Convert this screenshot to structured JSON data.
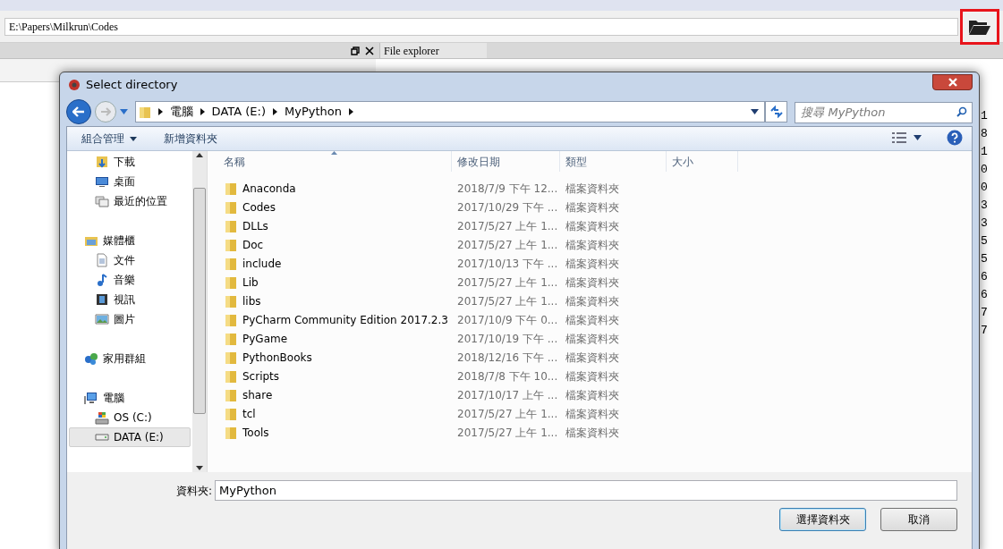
{
  "toolbar": {
    "path": "E:\\Papers\\Milkrun\\Codes"
  },
  "pane_header": {
    "title": "File explorer"
  },
  "background_column": [
    "1",
    "8",
    "1",
    "0",
    "0",
    "3",
    "3",
    "5",
    "5",
    "6",
    "6",
    "7",
    "7"
  ],
  "dialog": {
    "title": "Select directory",
    "breadcrumbs": [
      "電腦",
      "DATA (E:)",
      "MyPython"
    ],
    "search": {
      "placeholder": "搜尋 MyPython"
    },
    "commands": [
      {
        "label": "組合管理",
        "dropdown": true
      },
      {
        "label": "新增資料夾",
        "dropdown": false
      }
    ],
    "nav": [
      {
        "children": [
          {
            "label": "下載",
            "kind": "download",
            "selected": false
          },
          {
            "label": "桌面",
            "kind": "desktop",
            "selected": false
          },
          {
            "label": "最近的位置",
            "kind": "recent",
            "selected": false
          }
        ]
      },
      {
        "label": "媒體櫃",
        "kind": "library",
        "selected": false,
        "children": [
          {
            "label": "文件",
            "kind": "document",
            "selected": false
          },
          {
            "label": "音樂",
            "kind": "music",
            "selected": false
          },
          {
            "label": "視訊",
            "kind": "video",
            "selected": false
          },
          {
            "label": "圖片",
            "kind": "picture",
            "selected": false
          }
        ]
      },
      {
        "label": "家用群組",
        "kind": "homegroup",
        "selected": false
      },
      {
        "label": "電腦",
        "kind": "computer",
        "selected": false,
        "children": [
          {
            "label": "OS (C:)",
            "kind": "osdrive",
            "selected": false
          },
          {
            "label": "DATA (E:)",
            "kind": "drive",
            "selected": true
          }
        ]
      }
    ],
    "columns": [
      "名稱",
      "修改日期",
      "類型",
      "大小"
    ],
    "rows": [
      {
        "name": "Anaconda",
        "modified": "2018/7/9 下午 12...",
        "type": "檔案資料夾"
      },
      {
        "name": "Codes",
        "modified": "2017/10/29 下午 ...",
        "type": "檔案資料夾"
      },
      {
        "name": "DLLs",
        "modified": "2017/5/27 上午 1...",
        "type": "檔案資料夾"
      },
      {
        "name": "Doc",
        "modified": "2017/5/27 上午 1...",
        "type": "檔案資料夾"
      },
      {
        "name": "include",
        "modified": "2017/10/13 下午 ...",
        "type": "檔案資料夾"
      },
      {
        "name": "Lib",
        "modified": "2017/5/27 上午 1...",
        "type": "檔案資料夾"
      },
      {
        "name": "libs",
        "modified": "2017/5/27 上午 1...",
        "type": "檔案資料夾"
      },
      {
        "name": "PyCharm Community Edition 2017.2.3",
        "modified": "2017/10/9 下午 0...",
        "type": "檔案資料夾"
      },
      {
        "name": "PyGame",
        "modified": "2017/10/19 下午 ...",
        "type": "檔案資料夾"
      },
      {
        "name": "PythonBooks",
        "modified": "2018/12/16 下午 ...",
        "type": "檔案資料夾"
      },
      {
        "name": "Scripts",
        "modified": "2018/7/8 下午 10...",
        "type": "檔案資料夾"
      },
      {
        "name": "share",
        "modified": "2017/10/17 上午 ...",
        "type": "檔案資料夾"
      },
      {
        "name": "tcl",
        "modified": "2017/5/27 上午 1...",
        "type": "檔案資料夾"
      },
      {
        "name": "Tools",
        "modified": "2017/5/27 上午 1...",
        "type": "檔案資料夾"
      }
    ],
    "folder_label": "資料夾:",
    "folder_value": "MyPython",
    "buttons": [
      {
        "label": "選擇資料夾",
        "kind": "primary"
      },
      {
        "label": "取消",
        "kind": "secondary"
      }
    ]
  }
}
